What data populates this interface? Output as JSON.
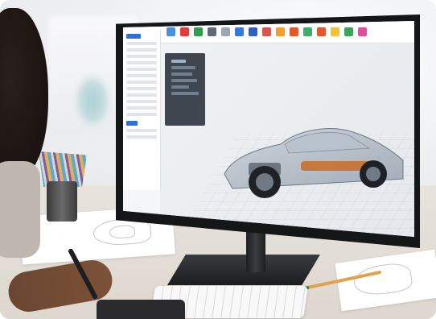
{
  "image": {
    "description_subject": "designer-desk-monitor-3d-car"
  },
  "screen_app": {
    "toolbar": {
      "tools": [
        {
          "icon": "select-tool-icon",
          "color": "#4a90e2"
        },
        {
          "icon": "axis-tool-icon",
          "color": "#e23c3c"
        },
        {
          "icon": "extrude-tool-icon",
          "color": "#2e9e4f"
        },
        {
          "icon": "rotate-tool-icon",
          "color": "#5b6b7a"
        },
        {
          "icon": "document-tool-icon",
          "color": "#9aa7b4"
        },
        {
          "icon": "layers-tool-icon",
          "color": "#3a78d8"
        },
        {
          "icon": "cube-tool-icon",
          "color": "#2f5fc0"
        },
        {
          "icon": "chart-tool-icon",
          "color": "#d9534f"
        },
        {
          "icon": "shape-tool-icon",
          "color": "#f0a030"
        },
        {
          "icon": "paint-tool-icon",
          "color": "#e05a2b"
        },
        {
          "icon": "measure-tool-icon",
          "color": "#3cae6a"
        },
        {
          "icon": "cut-tool-icon",
          "color": "#e4572e"
        },
        {
          "icon": "palette-tool-icon",
          "color": "#f2c230"
        },
        {
          "icon": "material-tool-icon",
          "color": "#3da35d"
        },
        {
          "icon": "color-tool-icon",
          "color": "#e24ca0"
        }
      ]
    },
    "accent": "#2f6fd6"
  }
}
